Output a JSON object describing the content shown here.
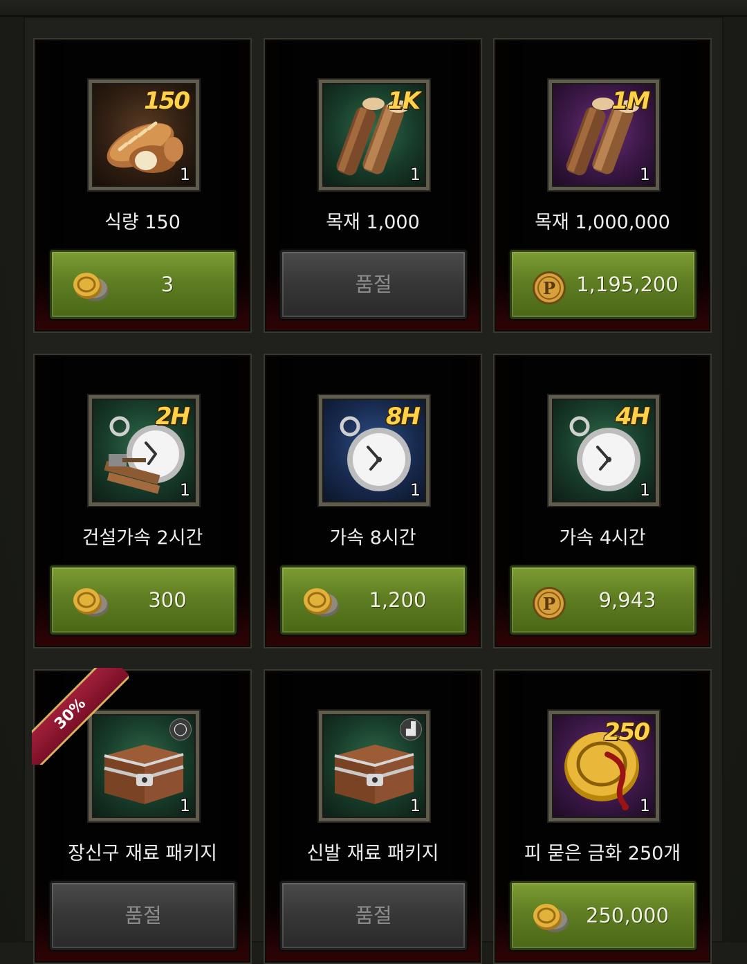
{
  "items": [
    {
      "badge": "150",
      "qty": "1",
      "name": "식량 150",
      "price": "3",
      "currency": "gold-coins",
      "status": "available",
      "bg": "brown",
      "art": "bread-icon"
    },
    {
      "badge": "1K",
      "qty": "1",
      "name": "목재 1,000",
      "price": "품절",
      "currency": "",
      "status": "sold-out",
      "bg": "green",
      "art": "wood-icon"
    },
    {
      "badge": "1M",
      "qty": "1",
      "name": "목재 1,000,000",
      "price": "1,195,200",
      "currency": "p-coin",
      "status": "available",
      "bg": "purple",
      "art": "wood-icon"
    },
    {
      "badge": "2H",
      "qty": "1",
      "name": "건설가속 2시간",
      "price": "300",
      "currency": "gold-coins",
      "status": "available",
      "bg": "green",
      "art": "construction-speedup-icon"
    },
    {
      "badge": "8H",
      "qty": "1",
      "name": "가속 8시간",
      "price": "1,200",
      "currency": "gold-coins",
      "status": "available",
      "bg": "blue",
      "art": "stopwatch-icon"
    },
    {
      "badge": "4H",
      "qty": "1",
      "name": "가속 4시간",
      "price": "9,943",
      "currency": "p-coin",
      "status": "available",
      "bg": "green",
      "art": "stopwatch-icon"
    },
    {
      "badge": "",
      "qty": "1",
      "name": "장신구 재료 패키지",
      "price": "품절",
      "currency": "",
      "status": "sold-out",
      "bg": "green",
      "art": "treasure-chest-icon",
      "slot": "ring-icon",
      "ribbon": "30%"
    },
    {
      "badge": "",
      "qty": "1",
      "name": "신발 재료 패키지",
      "price": "품절",
      "currency": "",
      "status": "sold-out",
      "bg": "green",
      "art": "treasure-chest-icon",
      "slot": "boot-icon"
    },
    {
      "badge": "250",
      "qty": "1",
      "name": "피 묻은 금화 250개",
      "price": "250,000",
      "currency": "gold-coins",
      "status": "available",
      "bg": "purple",
      "art": "bloody-gold-coin-icon"
    }
  ],
  "colors": {
    "button_green": "#5f7e22",
    "button_gray": "#363636",
    "badge_gold": "#ffd24a",
    "ribbon": "#a11e3a"
  }
}
